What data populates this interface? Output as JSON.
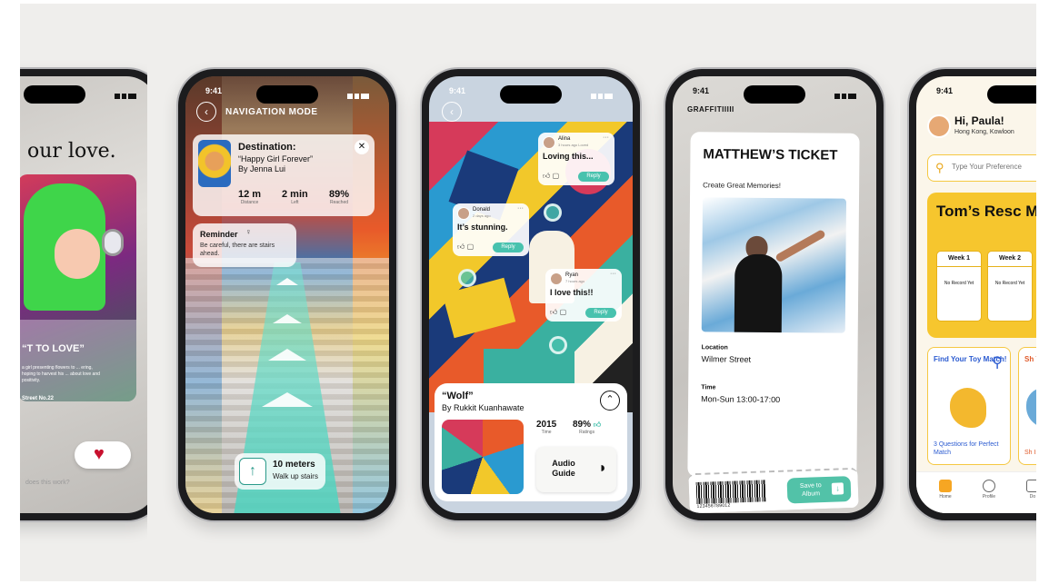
{
  "phone1": {
    "headline": "our love.",
    "quote": "“T TO LOVE”",
    "body": "a girl presenting flowers to ... ering, hoping to harvest his ... about love and positivity.",
    "street": "Street No.22",
    "footer": "does this work?"
  },
  "phone2": {
    "time": "9:41",
    "title": "NAVIGATION MODE",
    "destination_label": "Destination:",
    "destination_name": "“Happy Girl Forever”\nBy Jenna Lui",
    "stats": [
      {
        "value": "12 m",
        "label": "Distance"
      },
      {
        "value": "2 min",
        "label": "Left"
      },
      {
        "value": "89%",
        "label": "Reached"
      }
    ],
    "reminder_title": "Reminder",
    "reminder_text": "Be careful, there are stairs ahead.",
    "distance": "10 meters",
    "instruction": "Walk up stairs"
  },
  "phone3": {
    "time": "9:41",
    "comments": [
      {
        "name": "Alina",
        "ago": "3 hours ago Loved",
        "message": "Loving this...",
        "reply": "Reply"
      },
      {
        "name": "Donald",
        "ago": "2 days ago",
        "message": "It’s stunning.",
        "reply": "Reply"
      },
      {
        "name": "Ryan",
        "ago": "7 hours ago",
        "message": "I love this!!",
        "reply": "Reply"
      }
    ],
    "artwork_title": "“Wolf”",
    "artist": "By Rukkit Kuanhawate",
    "year": "2015",
    "year_label": "Time",
    "rating": "89%",
    "rating_label": "Ratings",
    "audio_label": "Audio Guide"
  },
  "phone4": {
    "time": "9:41",
    "brand": "GRAFFITIIIII",
    "ticket_title": "MATTHEW’S TICKET",
    "subtitle": "Create Great Memories!",
    "location_label": "Location",
    "location_value": "Wilmer Street",
    "time_label": "Time",
    "time_value": "Mon-Sun 13:00-17:00",
    "barcode_number": "123456789012",
    "save_label": "Save to Album"
  },
  "phone5": {
    "time": "9:41",
    "greeting": "Hi, Paula!",
    "location": "Hong Kong, Kowloon",
    "search_placeholder": "Type Your Preference",
    "milestone_title": "Tom’s Resc Milestone",
    "weeks": [
      {
        "label": "Week 1",
        "status": "No Record Yet"
      },
      {
        "label": "Week 2",
        "status": "No Record Yet"
      }
    ],
    "tile1_title": "Find Your Toy Match!",
    "tile1_caption": "3 Questions for Perfect Match",
    "tile2_title": "Sh To",
    "tile2_caption": "Sh Is C",
    "nav": [
      "Home",
      "Profile",
      "Do"
    ]
  },
  "colors": {
    "teal": "#48c2ae",
    "yellow": "#f6c62e",
    "heart_red": "#c8102e",
    "link_blue": "#2a5ad0"
  }
}
